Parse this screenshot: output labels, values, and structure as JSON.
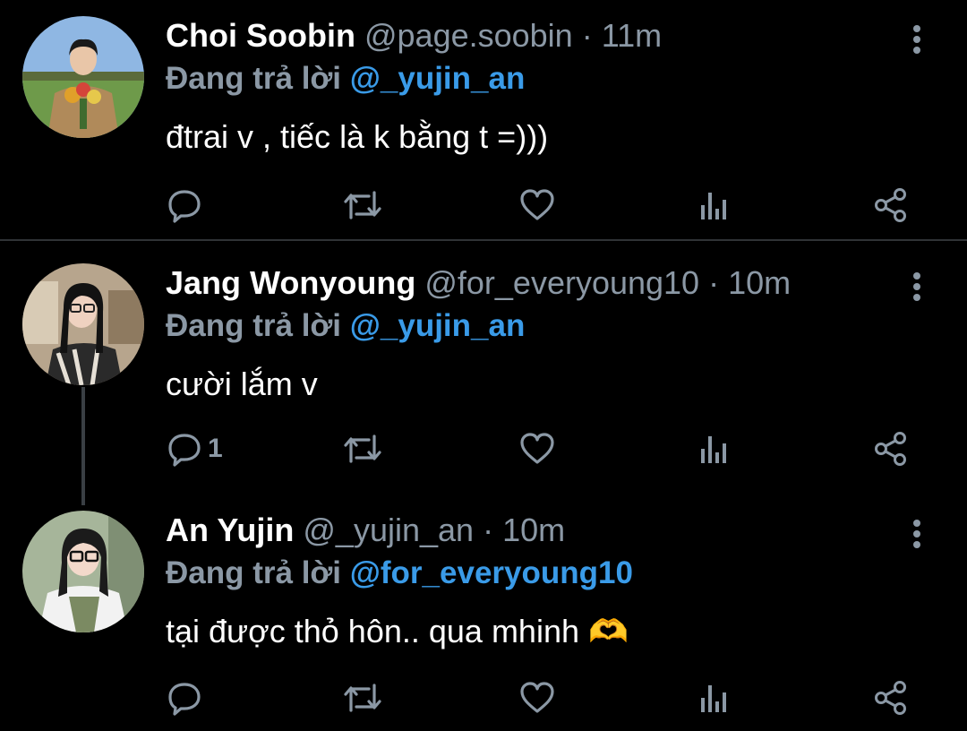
{
  "tweets": [
    {
      "name": "Choi Soobin",
      "handle": "@page.soobin",
      "separator": "·",
      "time": "11m",
      "replying_prefix": "Đang trả lời",
      "replying_to": "@_yujin_an",
      "text": "đtrai v , tiếc là k bằng t =)))",
      "reply_count": "",
      "avatar_colors": {
        "sky": "#8fb7e3",
        "grass": "#6e9a4a",
        "coat": "#b08a5a",
        "hair": "#1a1a1a",
        "skin": "#e9c6a8"
      }
    },
    {
      "name": "Jang Wonyoung",
      "handle": "@for_everyoung10",
      "separator": "·",
      "time": "10m",
      "replying_prefix": "Đang trả lời",
      "replying_to": "@_yujin_an",
      "text": "cười lắm v",
      "reply_count": "1",
      "avatar_colors": {
        "bg": "#b7a58d",
        "shirt": "#2a2a2a",
        "hair": "#121212",
        "skin": "#efd2c0"
      }
    },
    {
      "name": "An Yujin",
      "handle": "@_yujin_an",
      "separator": "·",
      "time": "10m",
      "replying_prefix": "Đang trả lời",
      "replying_to": "@for_everyoung10",
      "text": "tại được thỏ hôn.. qua mhinh",
      "emoji": "🫶",
      "reply_count": "",
      "avatar_colors": {
        "bg": "#a6b59a",
        "shirt": "#f2f2f2",
        "hair": "#1b1b1b",
        "skin": "#f3d9cb"
      }
    }
  ],
  "theme": {
    "background": "#000000",
    "name_color": "#ffffff",
    "muted": "#8b98a5",
    "mention": "#3a9be8",
    "divider": "#2f3336"
  },
  "icons": [
    "reply-icon",
    "retweet-icon",
    "like-icon",
    "analytics-icon",
    "share-icon",
    "more-options-icon"
  ]
}
